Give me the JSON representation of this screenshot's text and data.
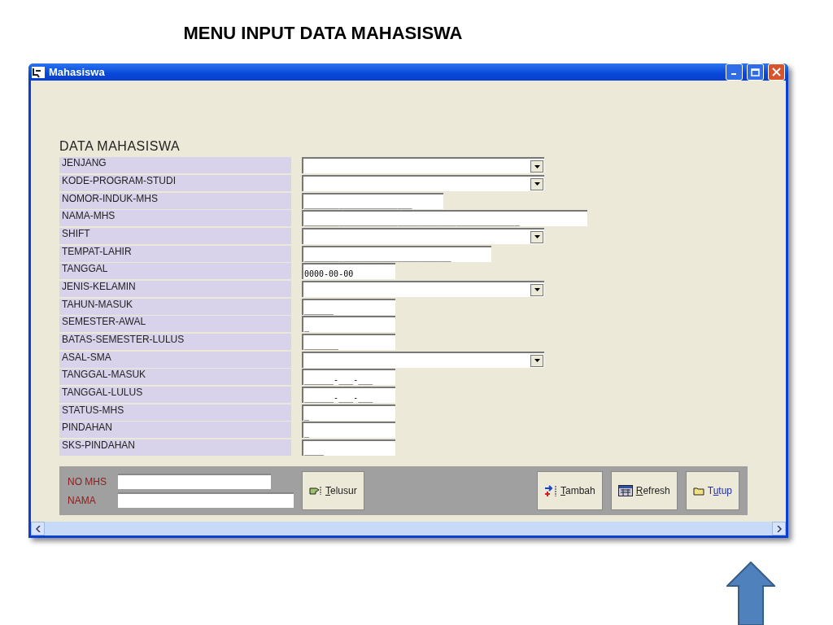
{
  "slide_title": "MENU INPUT DATA MAHASISWA",
  "window": {
    "title": "Mahasiswa"
  },
  "form": {
    "heading": "DATA MAHASISWA",
    "fields": [
      {
        "label": "JENJANG",
        "kind": "combo"
      },
      {
        "label": "KODE-PROGRAM-STUDI",
        "kind": "combo"
      },
      {
        "label": "NOMOR-INDUK-MHS",
        "kind": "text",
        "value": "______________________"
      },
      {
        "label": "NAMA-MHS",
        "kind": "text",
        "value": "____________________________________________"
      },
      {
        "label": "SHIFT",
        "kind": "combo"
      },
      {
        "label": "TEMPAT-LAHIR",
        "kind": "text",
        "value": "______________________________"
      },
      {
        "label": "TANGGAL",
        "kind": "text",
        "value": "0000-00-00"
      },
      {
        "label": "JENIS-KELAMIN",
        "kind": "combo"
      },
      {
        "label": "TAHUN-MASUK",
        "kind": "text",
        "value": "______"
      },
      {
        "label": "SEMESTER-AWAL",
        "kind": "text",
        "value": "_"
      },
      {
        "label": "BATAS-SEMESTER-LULUS",
        "kind": "text",
        "value": "_______"
      },
      {
        "label": "ASAL-SMA",
        "kind": "combo"
      },
      {
        "label": "TANGGAL-MASUK",
        "kind": "text",
        "value": "______-___-___"
      },
      {
        "label": "TANGGAL-LULUS",
        "kind": "text",
        "value": "______-___-___"
      },
      {
        "label": "STATUS-MHS",
        "kind": "text",
        "value": "_"
      },
      {
        "label": "PINDAHAN",
        "kind": "text",
        "value": "_"
      },
      {
        "label": "SKS-PINDAHAN",
        "kind": "text",
        "value": "____"
      }
    ]
  },
  "search": {
    "fields": [
      {
        "label": "NO MHS"
      },
      {
        "label": "NAMA"
      }
    ],
    "button": {
      "key": "T",
      "after": "elusur"
    }
  },
  "buttons": [
    {
      "key": "T",
      "after": "ambah"
    },
    {
      "key": "R",
      "after": "efresh"
    },
    {
      "before": "T",
      "key": "u",
      "after": "tup"
    }
  ]
}
